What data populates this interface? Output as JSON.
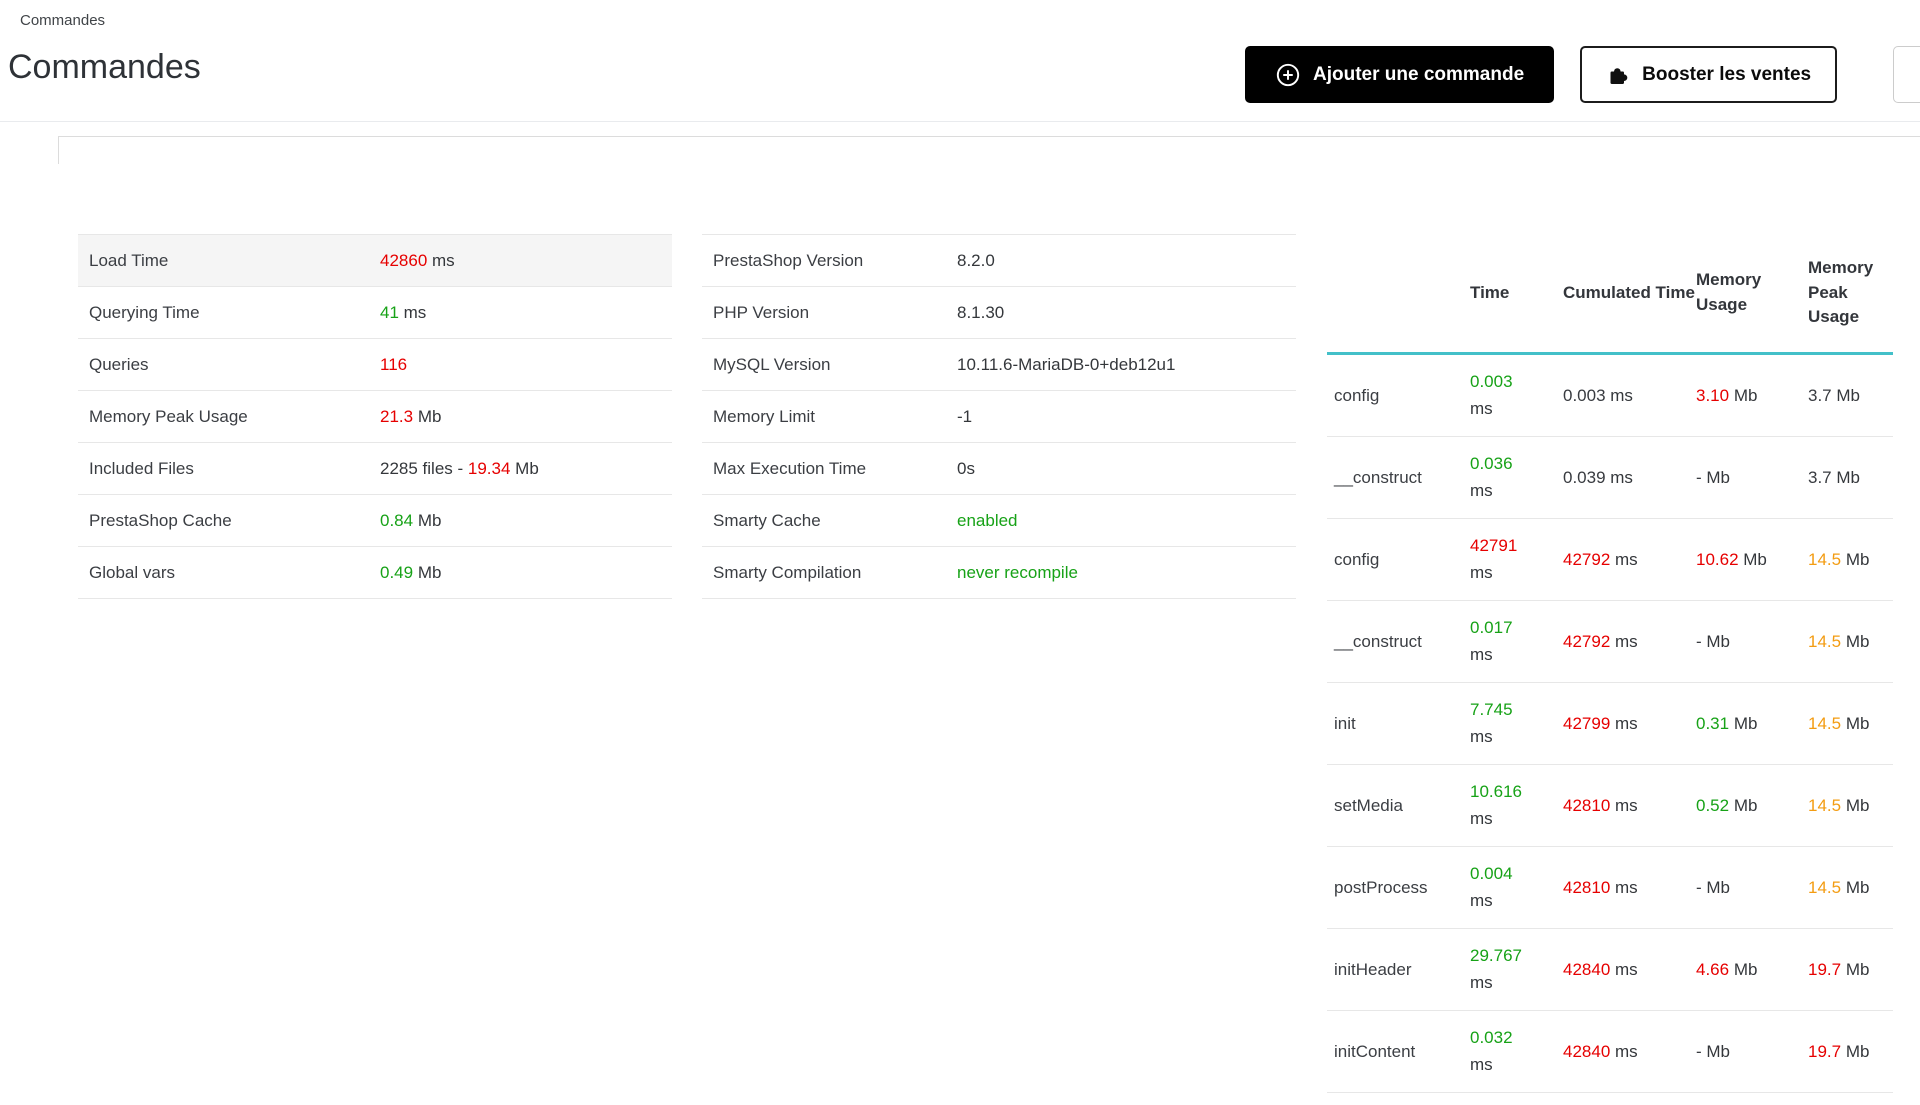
{
  "page": {
    "breadcrumb": "Commandes",
    "title": "Commandes"
  },
  "toolbar": {
    "add_order_label": "Ajouter une commande",
    "boost_sales_label": "Booster les ventes",
    "icons": {
      "add_order": "plus-circle-icon",
      "boost_sales": "puzzle-icon"
    }
  },
  "colors": {
    "danger": "#e60000",
    "success": "#17a217",
    "warning": "#f39c12",
    "profiler_header_accent": "#43c0c9",
    "primary_button": "#000000"
  },
  "debug_summary": {
    "rows": [
      {
        "label": "Load Time",
        "prefix": "",
        "value": "42860",
        "value_color": "red",
        "unit": " ms"
      },
      {
        "label": "Querying Time",
        "prefix": "",
        "value": "41",
        "value_color": "green",
        "unit": " ms"
      },
      {
        "label": "Queries",
        "prefix": "",
        "value": "116",
        "value_color": "red",
        "unit": ""
      },
      {
        "label": "Memory Peak Usage",
        "prefix": "",
        "value": "21.3",
        "value_color": "red",
        "unit": " Mb"
      },
      {
        "label": "Included Files",
        "prefix": "2285 files - ",
        "value": "19.34",
        "value_color": "red",
        "unit": " Mb"
      },
      {
        "label": "PrestaShop Cache",
        "prefix": "",
        "value": "0.84",
        "value_color": "green",
        "unit": " Mb"
      },
      {
        "label": "Global vars",
        "prefix": "",
        "value": "0.49",
        "value_color": "green",
        "unit": " Mb"
      }
    ]
  },
  "system_info": {
    "rows": [
      {
        "label": "PrestaShop Version",
        "value": "8.2.0",
        "value_color": "default"
      },
      {
        "label": "PHP Version",
        "value": "8.1.30",
        "value_color": "default"
      },
      {
        "label": "MySQL Version",
        "value": "10.11.6-MariaDB-0+deb12u1",
        "value_color": "default"
      },
      {
        "label": "Memory Limit",
        "value": "-1",
        "value_color": "default"
      },
      {
        "label": "Max Execution Time",
        "value": "0s",
        "value_color": "default"
      },
      {
        "label": "Smarty Cache",
        "value": "enabled",
        "value_color": "green"
      },
      {
        "label": "Smarty Compilation",
        "value": "never recompile",
        "value_color": "green"
      }
    ]
  },
  "profiler": {
    "headers": {
      "time": "Time",
      "cumulated_time": "Cumulated Time",
      "memory_usage": "Memory Usage",
      "memory_peak_usage": "Memory Peak Usage"
    },
    "rows": [
      {
        "name": "config",
        "time": {
          "value": "0.003",
          "color": "green",
          "unit": "ms"
        },
        "cumulated": {
          "value": "0.003",
          "color": "default",
          "unit": " ms"
        },
        "memory": {
          "value": "3.10",
          "color": "red",
          "unit": " Mb"
        },
        "peak": {
          "value": "3.7",
          "color": "default",
          "unit": " Mb"
        }
      },
      {
        "name": "__construct",
        "time": {
          "value": "0.036",
          "color": "green",
          "unit": "ms"
        },
        "cumulated": {
          "value": "0.039",
          "color": "default",
          "unit": " ms"
        },
        "memory": {
          "value": "-",
          "color": "default",
          "unit": " Mb"
        },
        "peak": {
          "value": "3.7",
          "color": "default",
          "unit": " Mb"
        }
      },
      {
        "name": "config",
        "time": {
          "value": "42791",
          "color": "red",
          "unit": "ms"
        },
        "cumulated": {
          "value": "42792",
          "color": "red",
          "unit": " ms"
        },
        "memory": {
          "value": "10.62",
          "color": "red",
          "unit": " Mb"
        },
        "peak": {
          "value": "14.5",
          "color": "orange",
          "unit": " Mb"
        }
      },
      {
        "name": "__construct",
        "time": {
          "value": "0.017",
          "color": "green",
          "unit": "ms"
        },
        "cumulated": {
          "value": "42792",
          "color": "red",
          "unit": " ms"
        },
        "memory": {
          "value": "-",
          "color": "default",
          "unit": " Mb"
        },
        "peak": {
          "value": "14.5",
          "color": "orange",
          "unit": " Mb"
        }
      },
      {
        "name": "init",
        "time": {
          "value": "7.745",
          "color": "green",
          "unit": "ms"
        },
        "cumulated": {
          "value": "42799",
          "color": "red",
          "unit": " ms"
        },
        "memory": {
          "value": "0.31",
          "color": "green",
          "unit": " Mb"
        },
        "peak": {
          "value": "14.5",
          "color": "orange",
          "unit": " Mb"
        }
      },
      {
        "name": "setMedia",
        "time": {
          "value": "10.616",
          "color": "green",
          "unit": "ms"
        },
        "cumulated": {
          "value": "42810",
          "color": "red",
          "unit": " ms"
        },
        "memory": {
          "value": "0.52",
          "color": "green",
          "unit": " Mb"
        },
        "peak": {
          "value": "14.5",
          "color": "orange",
          "unit": " Mb"
        }
      },
      {
        "name": "postProcess",
        "time": {
          "value": "0.004",
          "color": "green",
          "unit": "ms"
        },
        "cumulated": {
          "value": "42810",
          "color": "red",
          "unit": " ms"
        },
        "memory": {
          "value": "-",
          "color": "default",
          "unit": " Mb"
        },
        "peak": {
          "value": "14.5",
          "color": "orange",
          "unit": " Mb"
        }
      },
      {
        "name": "initHeader",
        "time": {
          "value": "29.767",
          "color": "green",
          "unit": "ms"
        },
        "cumulated": {
          "value": "42840",
          "color": "red",
          "unit": " ms"
        },
        "memory": {
          "value": "4.66",
          "color": "red",
          "unit": " Mb"
        },
        "peak": {
          "value": "19.7",
          "color": "red",
          "unit": " Mb"
        }
      },
      {
        "name": "initContent",
        "time": {
          "value": "0.032",
          "color": "green",
          "unit": "ms"
        },
        "cumulated": {
          "value": "42840",
          "color": "red",
          "unit": " ms"
        },
        "memory": {
          "value": "-",
          "color": "default",
          "unit": " Mb"
        },
        "peak": {
          "value": "19.7",
          "color": "red",
          "unit": " Mb"
        }
      }
    ]
  }
}
